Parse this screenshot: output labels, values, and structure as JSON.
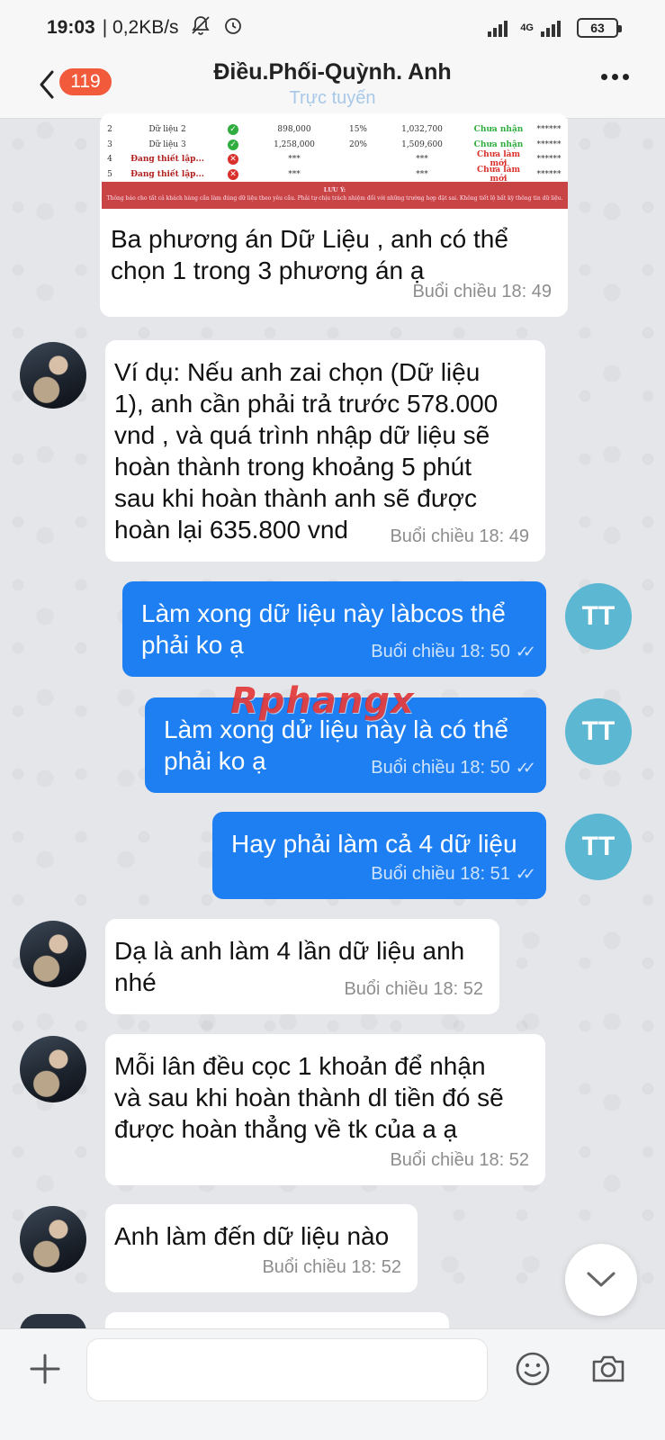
{
  "status_bar": {
    "time": "19:03",
    "net_speed": "| 0,2KB/s",
    "network_type": "4G",
    "battery": "63"
  },
  "header": {
    "unread_count": "119",
    "title": "Điều.Phối-Quỳnh. Anh",
    "status": "Trực tuyến"
  },
  "table_image": {
    "rows": [
      {
        "num": "2",
        "name": "Dữ liệu 2",
        "icon": "check",
        "value": "898,000",
        "percent": "15%",
        "total": "1,032,700",
        "status": "Chưa nhận",
        "pw": "******"
      },
      {
        "num": "3",
        "name": "Dữ liệu 3",
        "icon": "check",
        "value": "1,258,000",
        "percent": "20%",
        "total": "1,509,600",
        "status": "Chưa nhận",
        "pw": "******"
      },
      {
        "num": "4",
        "name": "Đang thiết lập...",
        "icon": "x",
        "value": "***",
        "percent": "",
        "total": "***",
        "status": "Chưa làm mới",
        "pw": "******"
      },
      {
        "num": "5",
        "name": "Đang thiết lập...",
        "icon": "x",
        "value": "***",
        "percent": "",
        "total": "***",
        "status": "Chưa làm mới",
        "pw": "******"
      }
    ],
    "notice_title": "LƯU Ý:",
    "notice_text": "Thông báo cho tất cả khách hàng cần làm đúng dữ liệu theo yêu cầu. Phải tự chịu trách nhiệm đối với những trường hợp đặt sai. Không tiết lộ bất kỳ thông tin dữ liệu."
  },
  "messages": [
    {
      "direction": "in",
      "text": "Ba phương án Dữ Liệu , anh có thể\nchọn 1 trong 3 phương án ạ",
      "time": "Buổi chiều  18: 49"
    },
    {
      "direction": "in",
      "text": "Ví dụ: Nếu anh zai chọn (Dữ liệu\n1), anh cần phải trả trước 578.000\nvnd , và quá trình nhập dữ liệu sẽ\nhoàn thành trong khoảng 5 phút\nsau khi hoàn thành anh sẽ được\nhoàn lại 635.800 vnd",
      "time": "Buổi chiều  18: 49"
    },
    {
      "direction": "out",
      "text": "Làm xong dữ liệu này làbcos thể\nphải ko ạ",
      "time": "Buổi chiều  18: 50",
      "avatar": "TT"
    },
    {
      "direction": "out",
      "text": "Làm xong dử liệu này là có thể\nphải ko ạ",
      "time": "Buổi chiều  18: 50",
      "avatar": "TT"
    },
    {
      "direction": "out",
      "text": "Hay phải làm cả 4 dữ liệu",
      "time": "Buổi chiều  18: 51",
      "avatar": "TT"
    },
    {
      "direction": "in",
      "text": "Dạ là anh làm 4 lần dữ liệu anh\nnhé",
      "time": "Buổi chiều  18: 52"
    },
    {
      "direction": "in",
      "text": "Mỗi lân đều cọc 1 khoản để nhận\nvà sau khi hoàn thành dl tiền đó sẽ\nđược hoàn thẳng về tk của a ạ",
      "time": "Buổi chiều  18: 52"
    },
    {
      "direction": "in",
      "text": "Anh làm đến dữ liệu nào",
      "time": "Buổi chiều  18: 52"
    }
  ],
  "watermark": "Rphangx",
  "input": {
    "value": "",
    "placeholder": ""
  },
  "colors": {
    "outgoing_bubble": "#1e7ff2",
    "incoming_bubble": "#ffffff",
    "badge": "#f25a3c",
    "tt_avatar": "#5bb7d2"
  },
  "icons": [
    "back-arrow-icon",
    "more-icon",
    "check-icon",
    "x-icon",
    "chevron-down-icon",
    "plus-icon",
    "emoji-icon",
    "camera-icon"
  ]
}
